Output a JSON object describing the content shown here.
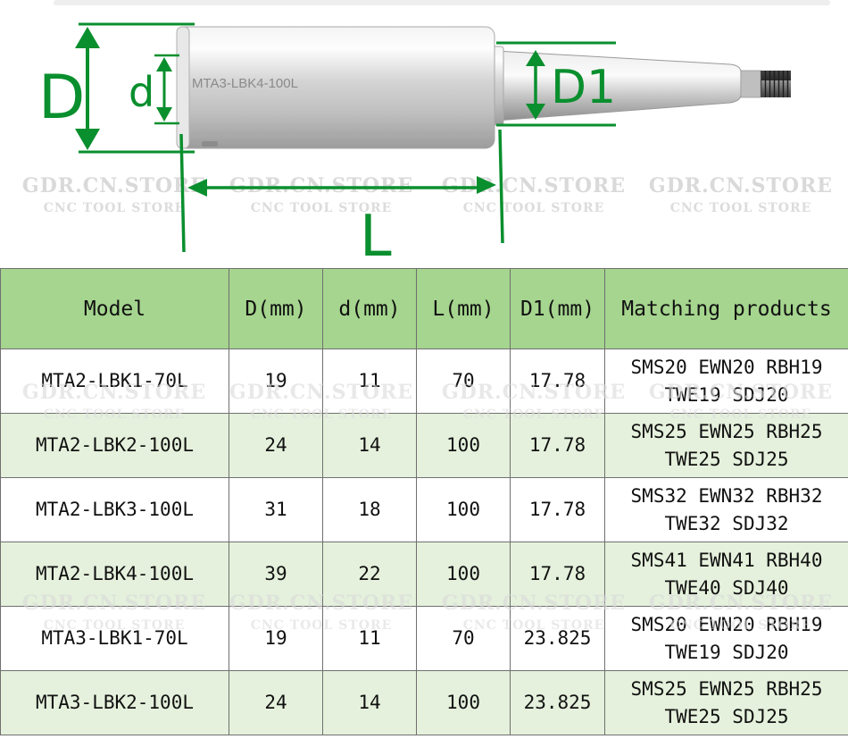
{
  "diagram": {
    "part_label": "MTA3-LBK4-100L",
    "dims": {
      "D": "D",
      "d": "d",
      "D1": "D1",
      "L": "L"
    },
    "watermark": {
      "main": "GDR.CN.STORE",
      "sub": "CNC TOOL STORE"
    },
    "accent_color": "#0a8f2e"
  },
  "table": {
    "header_color": "#a5d58e",
    "alt_row_color": "#e5f1dc",
    "headers": [
      "Model",
      "D(mm)",
      "d(mm)",
      "L(mm)",
      "D1(mm)",
      "Matching products"
    ],
    "rows": [
      {
        "model": "MTA2-LBK1-70L",
        "D": "19",
        "d": "11",
        "L": "70",
        "D1": "17.78",
        "match1": "SMS20 EWN20 RBH19",
        "match2": "TWE19 SDJ20"
      },
      {
        "model": "MTA2-LBK2-100L",
        "D": "24",
        "d": "14",
        "L": "100",
        "D1": "17.78",
        "match1": "SMS25 EWN25 RBH25",
        "match2": "TWE25 SDJ25"
      },
      {
        "model": "MTA2-LBK3-100L",
        "D": "31",
        "d": "18",
        "L": "100",
        "D1": "17.78",
        "match1": "SMS32 EWN32 RBH32",
        "match2": "TWE32 SDJ32"
      },
      {
        "model": "MTA2-LBK4-100L",
        "D": "39",
        "d": "22",
        "L": "100",
        "D1": "17.78",
        "match1": "SMS41 EWN41 RBH40",
        "match2": "TWE40 SDJ40"
      },
      {
        "model": "MTA3-LBK1-70L",
        "D": "19",
        "d": "11",
        "L": "70",
        "D1": "23.825",
        "match1": "SMS20 EWN20 RBH19",
        "match2": "TWE19 SDJ20"
      },
      {
        "model": "MTA3-LBK2-100L",
        "D": "24",
        "d": "14",
        "L": "100",
        "D1": "23.825",
        "match1": "SMS25 EWN25 RBH25",
        "match2": "TWE25 SDJ25"
      }
    ]
  }
}
